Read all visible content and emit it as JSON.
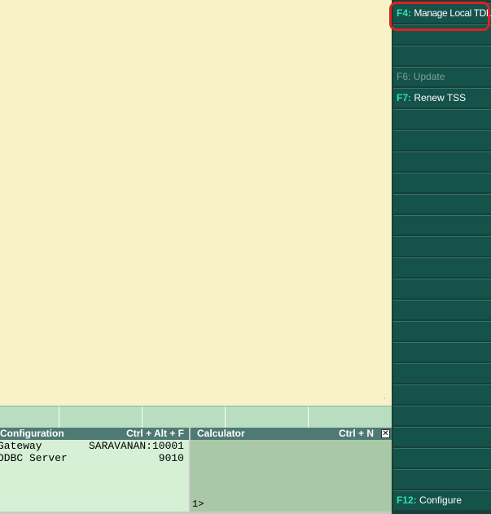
{
  "side_buttons": {
    "f4": {
      "key": "F4:",
      "label": "Manage Local TDL"
    },
    "f6": {
      "key": "F6:",
      "label": "Update"
    },
    "f7": {
      "key": "F7:",
      "label": "Renew TSS"
    },
    "f12": {
      "key": "F12:",
      "label": "Configure"
    }
  },
  "config_panel": {
    "title": "Configuration",
    "shortcut": "Ctrl + Alt + F",
    "rows": [
      {
        "label": "Gateway",
        "value": "SARAVANAN:10001"
      },
      {
        "label": "ODBC Server",
        "value": "9010"
      }
    ]
  },
  "calculator_panel": {
    "title": "Calculator",
    "shortcut": "Ctrl + N",
    "close_glyph": "✕",
    "prompt": "1>"
  },
  "colors": {
    "main_background": "#f8f2c8",
    "side_button": "#14524a",
    "hotkey_text": "#2fe0b0",
    "highlight_ring": "#e02020",
    "panel_header": "#4f7a74"
  }
}
